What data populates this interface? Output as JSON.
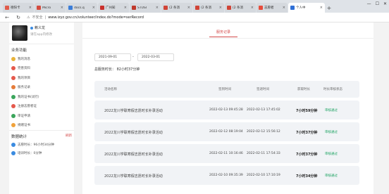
{
  "browser": {
    "tabs": [
      {
        "title": "德阳卡",
        "color": "#e05b4b",
        "active": false
      },
      {
        "title": "Micro",
        "color": "#d44b3f",
        "active": false
      },
      {
        "title": "docs.q",
        "color": "#3b7dd8",
        "active": false
      },
      {
        "title": "广州知",
        "color": "#c9302c",
        "active": false
      },
      {
        "title": "STUSI",
        "color": "#c0392b",
        "active": false
      },
      {
        "title": "(2 条消",
        "color": "#d04437",
        "active": false
      },
      {
        "title": "(2 条消",
        "color": "#d04437",
        "active": false
      },
      {
        "title": "(2 条消",
        "color": "#d04437",
        "active": false
      },
      {
        "title": "志愿者",
        "color": "#e74c3c",
        "active": false
      },
      {
        "title": "个人中",
        "color": "#2f6fd6",
        "active": true
      }
    ],
    "address": {
      "security_text": "不安全",
      "url": "www.izyz.gov.cn/volunteer/index.do?mode=serRecord"
    }
  },
  "sidebar": {
    "profile": {
      "name": "赖义龙",
      "subtitle": "请在app内修改"
    },
    "business_title": "业务功能",
    "menu": [
      {
        "label": "我的消息",
        "color": "#e8b33a"
      },
      {
        "label": "完善资料",
        "color": "#e5594c"
      },
      {
        "label": "我的项目",
        "color": "#e5594c"
      },
      {
        "label": "服务记录",
        "color": "#e57c3a"
      },
      {
        "label": "我的证书(试行)",
        "color": "#3aa55b"
      },
      {
        "label": "注册志愿者证",
        "color": "#e5594c"
      },
      {
        "label": "审证申请",
        "color": "#3aa55b"
      },
      {
        "label": "捐赠证书",
        "color": "#f0a23a"
      }
    ],
    "stats_title": "数据统计",
    "stats_refresh": "刷新",
    "stats": [
      {
        "label": "志愿时长：96小时34分钟",
        "color": "#3b8be0"
      },
      {
        "label": "培训时长：0分钟",
        "color": "#3b8be0"
      }
    ]
  },
  "main": {
    "tab_label": "服务记录",
    "date_from": "2021-09-01",
    "date_to": "2022-03-01",
    "dash": "-",
    "total_label": "总服务时长：  82小时37分钟",
    "columns": [
      "活动名称",
      "签到时间",
      "签退时间",
      "获取时长",
      "时长审核状态"
    ],
    "rows": [
      {
        "name": "2022龙川学联寒假志愿时长补录活动",
        "sign_in": "2022-02-13 09:45:28",
        "sign_out": "2022-02-13 17:45:02",
        "hours": "7小时59分钟",
        "status": "审核通过"
      },
      {
        "name": "2022龙川学联寒假志愿时长补录活动",
        "sign_in": "2022-02-12 08:19:04",
        "sign_out": "2022-02-12 15:56:12",
        "hours": "7小时37分钟",
        "status": "审核通过"
      },
      {
        "name": "2022龙川学联寒假志愿时长补录活动",
        "sign_in": "2022-02-11 10:16:46",
        "sign_out": "2022-02-11 17:54:33",
        "hours": "7小时37分钟",
        "status": "审核通过"
      },
      {
        "name": "2022龙川学联寒假志愿时长补录活动",
        "sign_in": "2022-02-10 09:35:39",
        "sign_out": "2022-02-10 17:10:19",
        "hours": "7小时34分钟",
        "status": "审核通过"
      }
    ]
  }
}
